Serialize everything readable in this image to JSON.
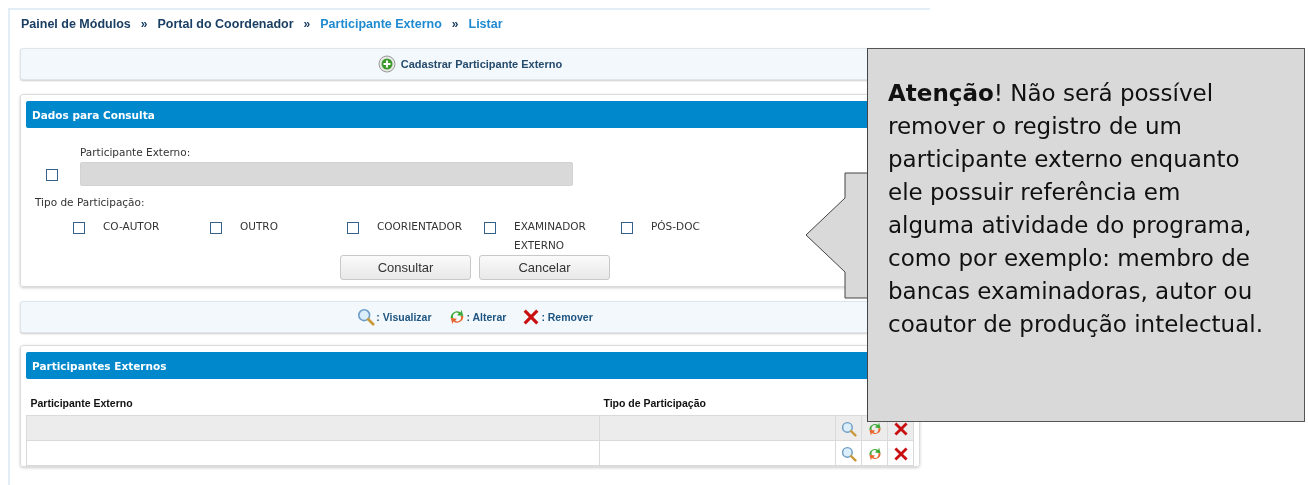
{
  "breadcrumb": [
    {
      "label": "Painel de Módulos",
      "current": false
    },
    {
      "label": "Portal do Coordenador",
      "current": false
    },
    {
      "label": "Participante Externo",
      "current": true
    },
    {
      "label": "Listar",
      "current": true
    }
  ],
  "breadcrumb_separator": "»",
  "add_action": {
    "label": "Cadastrar Participante Externo"
  },
  "search_panel": {
    "title": "Dados para Consulta",
    "field_checkbox": {
      "checked": false
    },
    "field_label": "Participante Externo:",
    "field_disabled": true,
    "type_label": "Tipo de Participação:",
    "types": [
      {
        "label": "CO-AUTOR",
        "checked": false
      },
      {
        "label": "OUTRO",
        "checked": false
      },
      {
        "label": "COORIENTADOR",
        "checked": false
      },
      {
        "label": "EXAMINADOR EXTERNO",
        "checked": false
      },
      {
        "label": "PÓS-DOC",
        "checked": false
      }
    ],
    "buttons": [
      "Consultar",
      "Cancelar"
    ]
  },
  "legend": [
    {
      "kind": "view",
      "label": ": Visualizar"
    },
    {
      "kind": "edit",
      "label": ": Alterar"
    },
    {
      "kind": "remove",
      "label": ": Remover"
    }
  ],
  "results_panel": {
    "title": "Participantes Externos",
    "columns": [
      "Participante Externo",
      "Tipo de Participação"
    ],
    "rows": [
      {
        "shaded": true,
        "actions": [
          {
            "kind": "view"
          },
          {
            "kind": "edit"
          },
          {
            "kind": "remove"
          }
        ]
      },
      {
        "shaded": false,
        "actions": [
          {
            "kind": "view"
          },
          {
            "kind": "edit"
          },
          {
            "kind": "remove"
          }
        ]
      }
    ]
  },
  "callout": {
    "text": "**Atenção**! Não será possível remover o registro de um participante externo enquanto ele possuir referência em alguma atividade do programa, como por exemplo: membro de bancas examinadoras, autor ou coautor de produção intelectual."
  }
}
